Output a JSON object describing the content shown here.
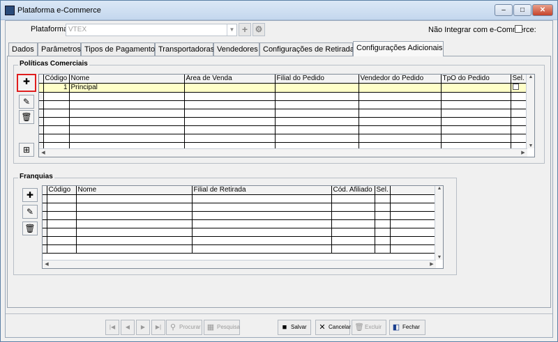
{
  "window": {
    "title": "Plataforma e-Commerce",
    "controls": {
      "minimize": "–",
      "maximize": "□",
      "close": "✕"
    }
  },
  "header": {
    "plataforma_label": "Plataforma:",
    "plataforma_value": "VTEX",
    "nao_integrar_label": "Não Integrar com e-Commerce:"
  },
  "tabs": [
    {
      "label": "Dados"
    },
    {
      "label": "Parâmetros"
    },
    {
      "label": "Tipos de Pagamento"
    },
    {
      "label": "Transportadoras"
    },
    {
      "label": "Vendedores"
    },
    {
      "label": "Configurações de Retirada"
    },
    {
      "label": "Configurações Adicionais"
    }
  ],
  "politicas": {
    "title": "Políticas Comerciais",
    "columns": [
      "Código",
      "Nome",
      "Área de Venda",
      "Filial do Pedido",
      "Vendedor do Pedido",
      "TpO do Pedido",
      "Sel."
    ],
    "rows": [
      {
        "codigo": "1",
        "nome": "Principal"
      }
    ]
  },
  "franquias": {
    "title": "Franquias",
    "columns": [
      "Código",
      "Nome",
      "Filial de Retirada",
      "Cód. Afiliado",
      "Sel."
    ]
  },
  "toolbar": {
    "procurar": "Procurar",
    "pesquisa": "Pesquisa",
    "salvar": "Salvar",
    "cancelar": "Cancelar",
    "excluir": "Excluir",
    "fechar": "Fechar"
  }
}
